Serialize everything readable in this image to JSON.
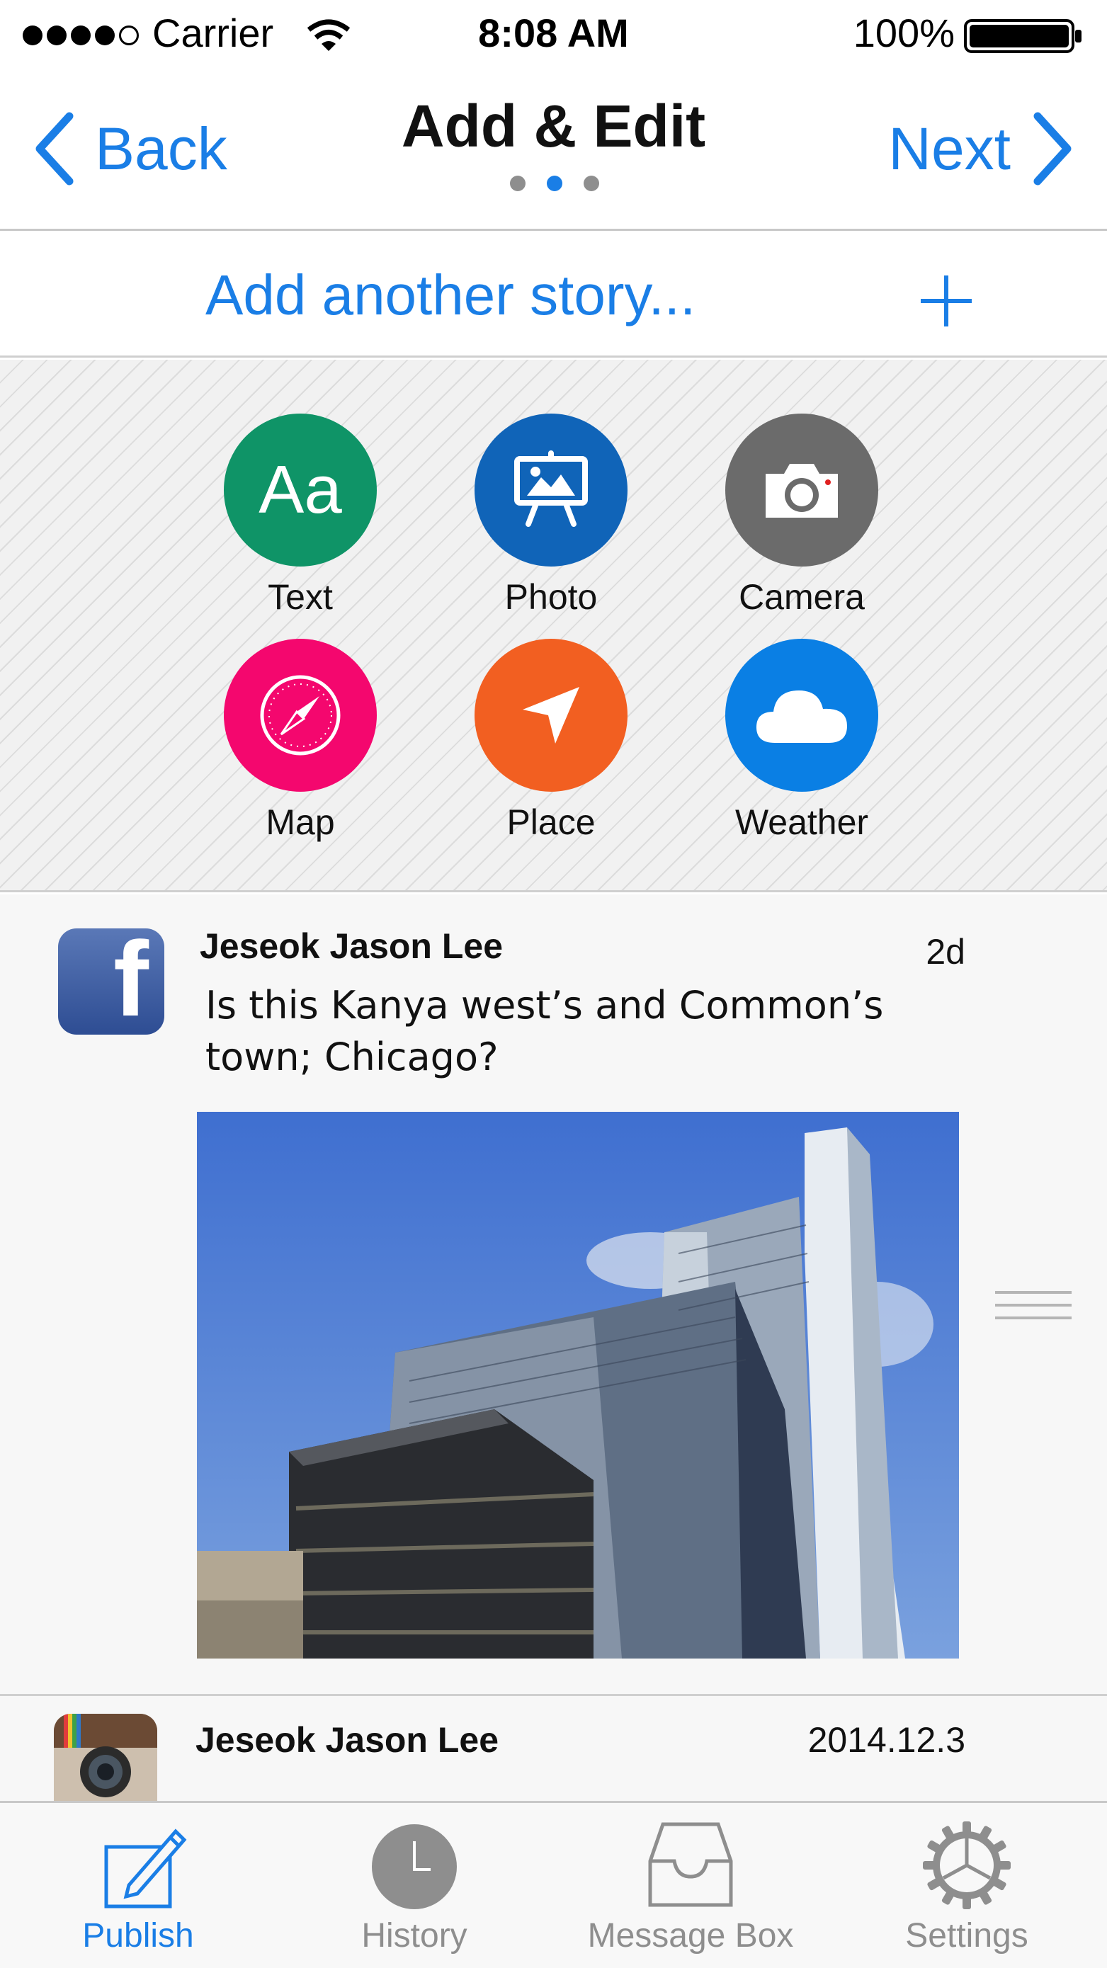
{
  "status_bar": {
    "carrier": "Carrier",
    "time": "8:08 AM",
    "battery": "100%"
  },
  "nav": {
    "back_label": "Back",
    "title": "Add & Edit",
    "next_label": "Next",
    "page_count": 3,
    "active_page": 2
  },
  "add_story": {
    "label": "Add another story..."
  },
  "story_types": [
    {
      "label": "Text",
      "icon": "text-aa-icon",
      "color": "#0f9467",
      "glyph": "Aa"
    },
    {
      "label": "Photo",
      "icon": "photo-easel-icon",
      "color": "#1064b8"
    },
    {
      "label": "Camera",
      "icon": "camera-icon",
      "color": "#6b6b6b"
    },
    {
      "label": "Map",
      "icon": "compass-icon",
      "color": "#f4076e"
    },
    {
      "label": "Place",
      "icon": "location-arrow-icon",
      "color": "#f25f21"
    },
    {
      "label": "Weather",
      "icon": "cloud-icon",
      "color": "#0a7fe4"
    }
  ],
  "feed": {
    "posts": [
      {
        "source": "facebook",
        "author": "Jeseok Jason Lee",
        "time": "2d",
        "text": "Is this Kanya west’s and Common’s town; Chicago?"
      },
      {
        "source": "instagram",
        "author": "Jeseok Jason Lee",
        "time": "2014.12.3"
      }
    ]
  },
  "tabs": [
    {
      "label": "Publish",
      "icon": "pencil-square-icon",
      "active": true
    },
    {
      "label": "History",
      "icon": "clock-icon",
      "active": false
    },
    {
      "label": "Message Box",
      "icon": "inbox-tray-icon",
      "active": false
    },
    {
      "label": "Settings",
      "icon": "gear-icon",
      "active": false
    }
  ],
  "colors": {
    "accent": "#1a7ee6",
    "inactive_tab": "#8e8e8e"
  }
}
